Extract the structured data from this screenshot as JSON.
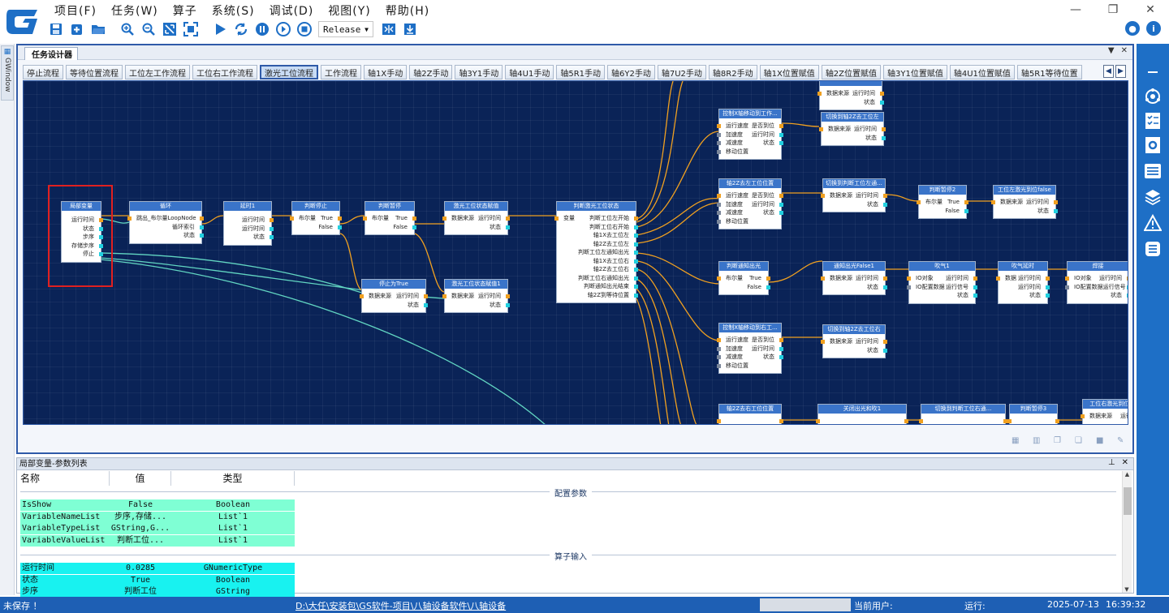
{
  "menu": [
    "项目(F)",
    "任务(W)",
    "算子",
    "系统(S)",
    "调试(D)",
    "视图(Y)",
    "帮助(H)"
  ],
  "toolbar": {
    "build_config": "Release",
    "icons": [
      "save-icon",
      "new-icon",
      "open-folder-icon",
      "zoom-in-icon",
      "zoom-out-icon",
      "fit-icon",
      "fullscreen-icon",
      "run-icon",
      "loop-run-icon",
      "pause-icon",
      "step-icon",
      "stop-icon",
      "align-icon",
      "download-icon"
    ]
  },
  "left_strip": {
    "tab_label": "GWindow"
  },
  "designer": {
    "tab_title": "任务设计器",
    "flow_tabs": [
      "停止流程",
      "等待位置流程",
      "工位左工作流程",
      "工位右工作流程",
      "激光工位流程",
      "工作流程",
      "轴1X手动",
      "轴2Z手动",
      "轴3Y1手动",
      "轴4U1手动",
      "轴5R1手动",
      "轴6Y2手动",
      "轴7U2手动",
      "轴8R2手动",
      "轴1X位置赋值",
      "轴2Z位置赋值",
      "轴3Y1位置赋值",
      "轴4U1位置赋值",
      "轴5R1等待位置"
    ],
    "active_tab_index": 4
  },
  "nodes": {
    "n1": {
      "title": "局部变量",
      "rows": [
        "运行时间",
        "状态",
        "步序",
        "存储步序",
        "停止"
      ]
    },
    "n2": {
      "title": "循环",
      "left": [
        "跳出_布尔量",
        "",
        ""
      ],
      "right": [
        "LoopNode",
        "循环索引",
        "状态"
      ]
    },
    "n3": {
      "title": "延时1",
      "rows": [
        "运行时间",
        "运行时间",
        "状态"
      ]
    },
    "n4": {
      "title": "判断停止",
      "left": [
        "布尔量",
        ""
      ],
      "right": [
        "True",
        "False"
      ]
    },
    "n5": {
      "title": "判断暂停",
      "left": [
        "布尔量",
        ""
      ],
      "right": [
        "True",
        "False"
      ]
    },
    "n6": {
      "title": "激光工位状态赋值",
      "left": [
        "数据来源",
        ""
      ],
      "right": [
        "运行时间",
        "状态"
      ]
    },
    "n7": {
      "title": "停止为True",
      "left": [
        "数据来源",
        ""
      ],
      "right": [
        "运行时间",
        "状态"
      ]
    },
    "n8": {
      "title": "激光工位状态赋值1",
      "left": [
        "数据来源",
        ""
      ],
      "right": [
        "运行时间",
        "状态"
      ]
    },
    "n9": {
      "title": "判断激光工位状态",
      "left": [
        "变量"
      ],
      "right": [
        "判断工位左开始",
        "判断工位右开始",
        "轴1X去工位左",
        "轴2Z去工位左",
        "判断工位左通知出光",
        "轴1X去工位右",
        "轴2Z去工位右",
        "判断工位右通知出光",
        "判断通知出光结束",
        "轴2Z到等待位置"
      ]
    },
    "n10": {
      "title": "控制X轴移动到工作...",
      "left": [
        "运行速度",
        "加速度",
        "减速度",
        "移动位置"
      ],
      "right": [
        "是否到位",
        "运行时间",
        "状态",
        ""
      ]
    },
    "n11": {
      "title": "切换到轴2Z去工位左",
      "left": [
        "数据来源"
      ],
      "right": [
        "运行时间",
        "状态"
      ]
    },
    "n12": {
      "title": "轴2Z去左工位位置",
      "left": [
        "运行速度",
        "加速度",
        "减速度",
        "移动位置"
      ],
      "right": [
        "是否到位",
        "运行时间",
        "状态",
        ""
      ]
    },
    "n13": {
      "title": "切换到判断工位左通...",
      "left": [
        "数据来源"
      ],
      "right": [
        "运行时间",
        "状态"
      ]
    },
    "n14": {
      "title": "判断暂停2",
      "left": [
        "布尔量"
      ],
      "right": [
        "True",
        "False"
      ]
    },
    "n15": {
      "title": "工位左激光到位false",
      "left": [
        "数据来源"
      ],
      "right": [
        "运行时间",
        "状态"
      ]
    },
    "n16": {
      "title": "判断通知出光",
      "left": [
        "布尔量"
      ],
      "right": [
        "True",
        "False"
      ]
    },
    "n17": {
      "title": "通知出光False1",
      "left": [
        "数据来源"
      ],
      "right": [
        "运行时间",
        "状态"
      ]
    },
    "n18": {
      "title": "吹气1",
      "left": [
        "IO对象",
        "IO配置数据"
      ],
      "right": [
        "运行时间",
        "运行信号",
        "状态"
      ]
    },
    "n19": {
      "title": "吹气延时",
      "left": [
        "数据",
        ""
      ],
      "right": [
        "运行时间",
        "运行时间",
        "状态"
      ]
    },
    "n20": {
      "title": "焊接",
      "left": [
        "IO对象",
        "IO配置数据"
      ],
      "right": [
        "运行时间",
        "运行信号",
        "状态"
      ]
    },
    "n21": {
      "title": "控制X轴移动到右工...",
      "left": [
        "运行速度",
        "加速度",
        "减速度",
        "移动位置"
      ],
      "right": [
        "是否到位",
        "运行时间",
        "状态",
        ""
      ]
    },
    "n22": {
      "title": "切换到轴2Z去工位右",
      "left": [
        "数据来源"
      ],
      "right": [
        "运行时间",
        "状态"
      ]
    },
    "n23": {
      "title": "轴2Z去右工位位置",
      "left": [],
      "right": []
    },
    "n24": {
      "title": "关闭出光和吹1",
      "left": [],
      "right": []
    },
    "n25": {
      "title": "切换到判断工位右通...",
      "left": [],
      "right": []
    },
    "n26": {
      "title": "判断暂停3",
      "left": [],
      "right": []
    },
    "n27": {
      "title": "工位右激光到位f",
      "left": [
        "数据来源"
      ],
      "right": [
        "运行"
      ]
    },
    "n28": {
      "title": "",
      "left": [
        "数据来源"
      ],
      "right": [
        "运行时间",
        "状态"
      ]
    }
  },
  "params": {
    "panel_title": "局部变量-参数列表",
    "columns": [
      "名称",
      "值",
      "类型"
    ],
    "section_config": "配置参数",
    "config_rows": [
      {
        "name": "IsShow",
        "value": "False",
        "type": "Boolean"
      },
      {
        "name": "VariableNameList",
        "value": "步序,存储...",
        "type": "List`1"
      },
      {
        "name": "VariableTypeList",
        "value": "GString,G...",
        "type": "List`1"
      },
      {
        "name": "VariableValueList",
        "value": "判断工位...",
        "type": "List`1"
      }
    ],
    "section_input": "算子输入",
    "input_rows": [
      {
        "name": "运行时间",
        "value": "0.0285",
        "type": "GNumericType"
      },
      {
        "name": "状态",
        "value": "True",
        "type": "Boolean"
      },
      {
        "name": "步序",
        "value": "判断工位",
        "type": "GString"
      }
    ]
  },
  "right_bar": {
    "icons": [
      "minimize-panel-icon",
      "network-icon",
      "checklist-icon",
      "settings-doc-icon",
      "list-view-icon",
      "layers-icon",
      "warning-icon",
      "flow-icon"
    ]
  },
  "status": {
    "save_state": "未保存 ！",
    "path": "D:\\大任\\安装包\\GS软件-项目\\八轴设备软件\\八轴设备",
    "user_label": "当前用户:",
    "run_label": "运行:",
    "date": "2025-07-13",
    "time": "16:39:32"
  },
  "colors": {
    "accent": "#1e6fc6",
    "canvas_bg": "#0a2357",
    "node_header": "#3a74c9",
    "wire_orange": "#f0a020",
    "wire_teal": "#62d6c2",
    "config_row": "#7fffd4",
    "input_row": "#18f2f0",
    "highlight": "#e02020"
  }
}
